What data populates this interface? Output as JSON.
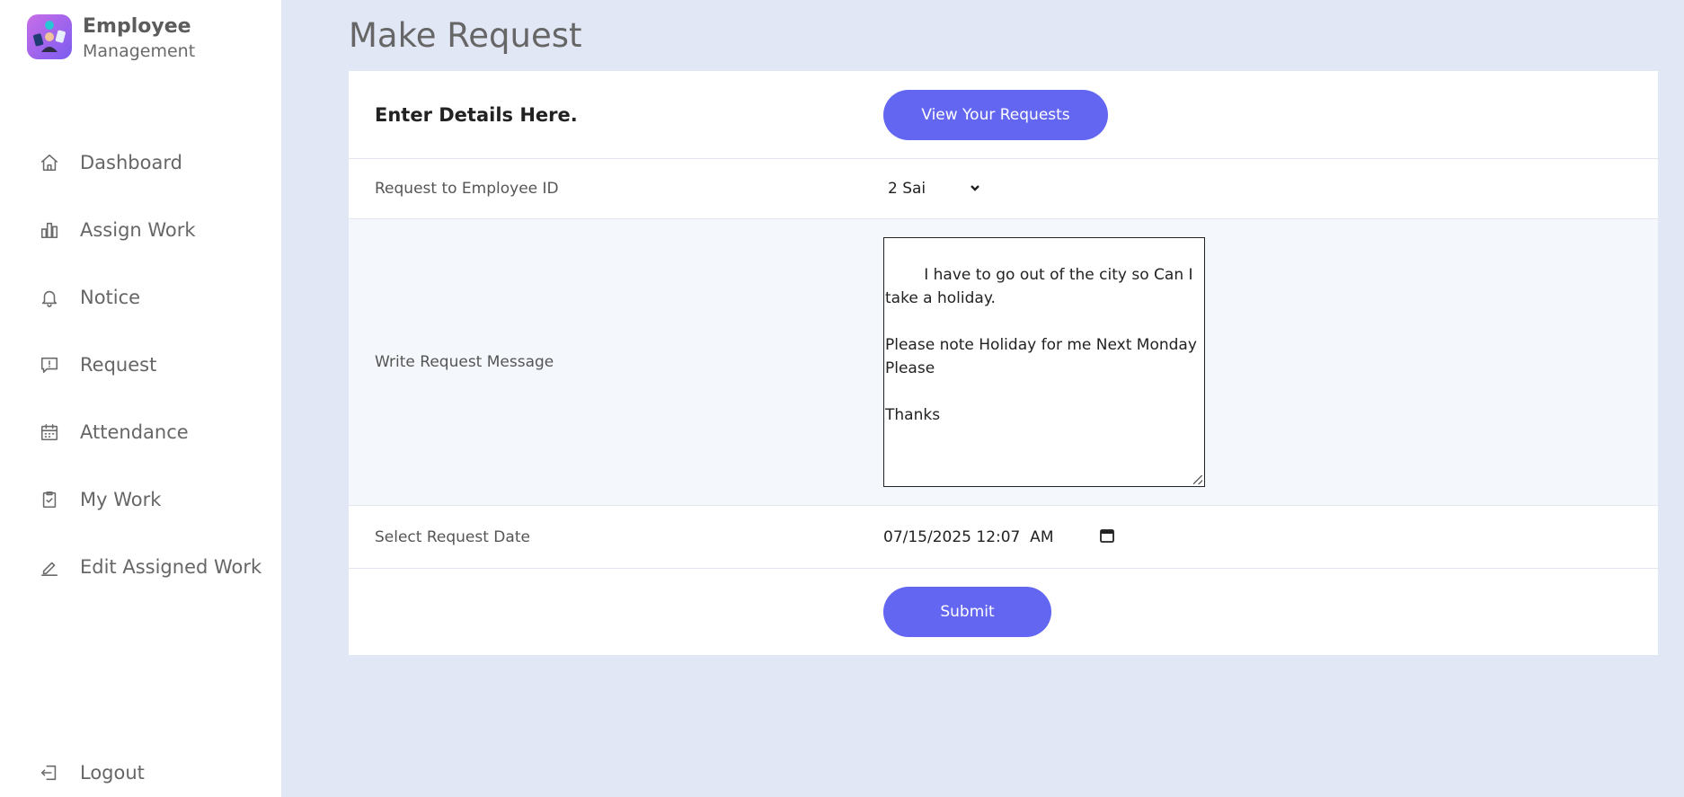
{
  "brand": {
    "title": "Employee",
    "subtitle": "Management"
  },
  "nav": {
    "items": [
      {
        "label": "Dashboard",
        "icon": "home-icon"
      },
      {
        "label": "Assign Work",
        "icon": "bar-chart-icon"
      },
      {
        "label": "Notice",
        "icon": "bell-icon"
      },
      {
        "label": "Request",
        "icon": "message-alert-icon"
      },
      {
        "label": "Attendance",
        "icon": "calendar-icon"
      },
      {
        "label": "My Work",
        "icon": "clipboard-check-icon"
      },
      {
        "label": "Edit Assigned Work",
        "icon": "pencil-icon"
      }
    ],
    "logout": {
      "label": "Logout",
      "icon": "logout-icon"
    }
  },
  "page": {
    "title": "Make Request"
  },
  "form": {
    "heading": "Enter Details Here.",
    "view_button": "View Your Requests",
    "employee_label": "Request to Employee ID",
    "employee_value": "2 Sai",
    "message_label": "Write Request Message",
    "message_value": "I have to go out of the city so Can I take a holiday.\n\nPlease note Holiday for me Next Monday Please\n\nThanks",
    "date_label": "Select Request Date",
    "date_value": "07/15/2025 12:07  AM",
    "submit_button": "Submit"
  },
  "colors": {
    "accent": "#6366f1",
    "background": "#e2e7f6"
  }
}
